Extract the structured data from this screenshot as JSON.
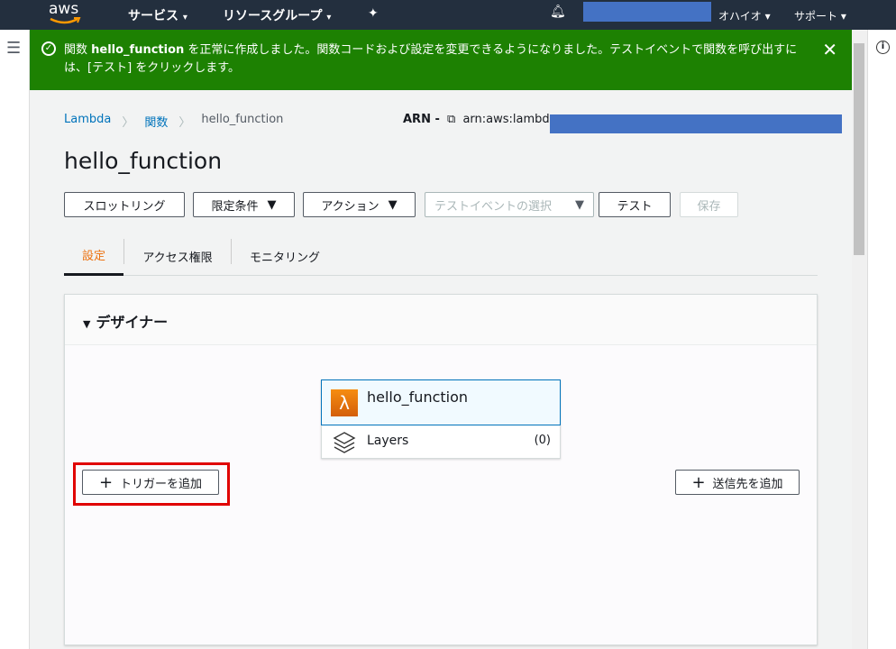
{
  "topnav": {
    "logo": "aws",
    "services": "サービス",
    "resource_groups": "リソースグループ",
    "region": "オハイオ",
    "support": "サポート"
  },
  "banner": {
    "prefix": "関数 ",
    "function_name": "hello_function",
    "message": " を正常に作成しました。関数コードおよび設定を変更できるようになりました。テストイベントで関数を呼び出すには、[テスト] をクリックします。"
  },
  "breadcrumb": [
    "Lambda",
    "関数",
    "hello_function"
  ],
  "arn": {
    "label": "ARN -",
    "value": "arn:aws:lambda:"
  },
  "title": "hello_function",
  "toolbar": {
    "throttle": "スロットリング",
    "qualifiers": "限定条件",
    "actions": "アクション",
    "test_event_placeholder": "テストイベントの選択",
    "test": "テスト",
    "save": "保存"
  },
  "tabs": [
    "設定",
    "アクセス権限",
    "モニタリング"
  ],
  "designer": {
    "title": "デザイナー",
    "function_name": "hello_function",
    "layers_label": "Layers",
    "layers_count": "(0)",
    "add_trigger": "トリガーを追加",
    "add_destination": "送信先を追加"
  },
  "colors": {
    "nav": "#232f3e",
    "banner": "#1d8102",
    "accent": "#ec7211",
    "highlight": "#e00000"
  }
}
